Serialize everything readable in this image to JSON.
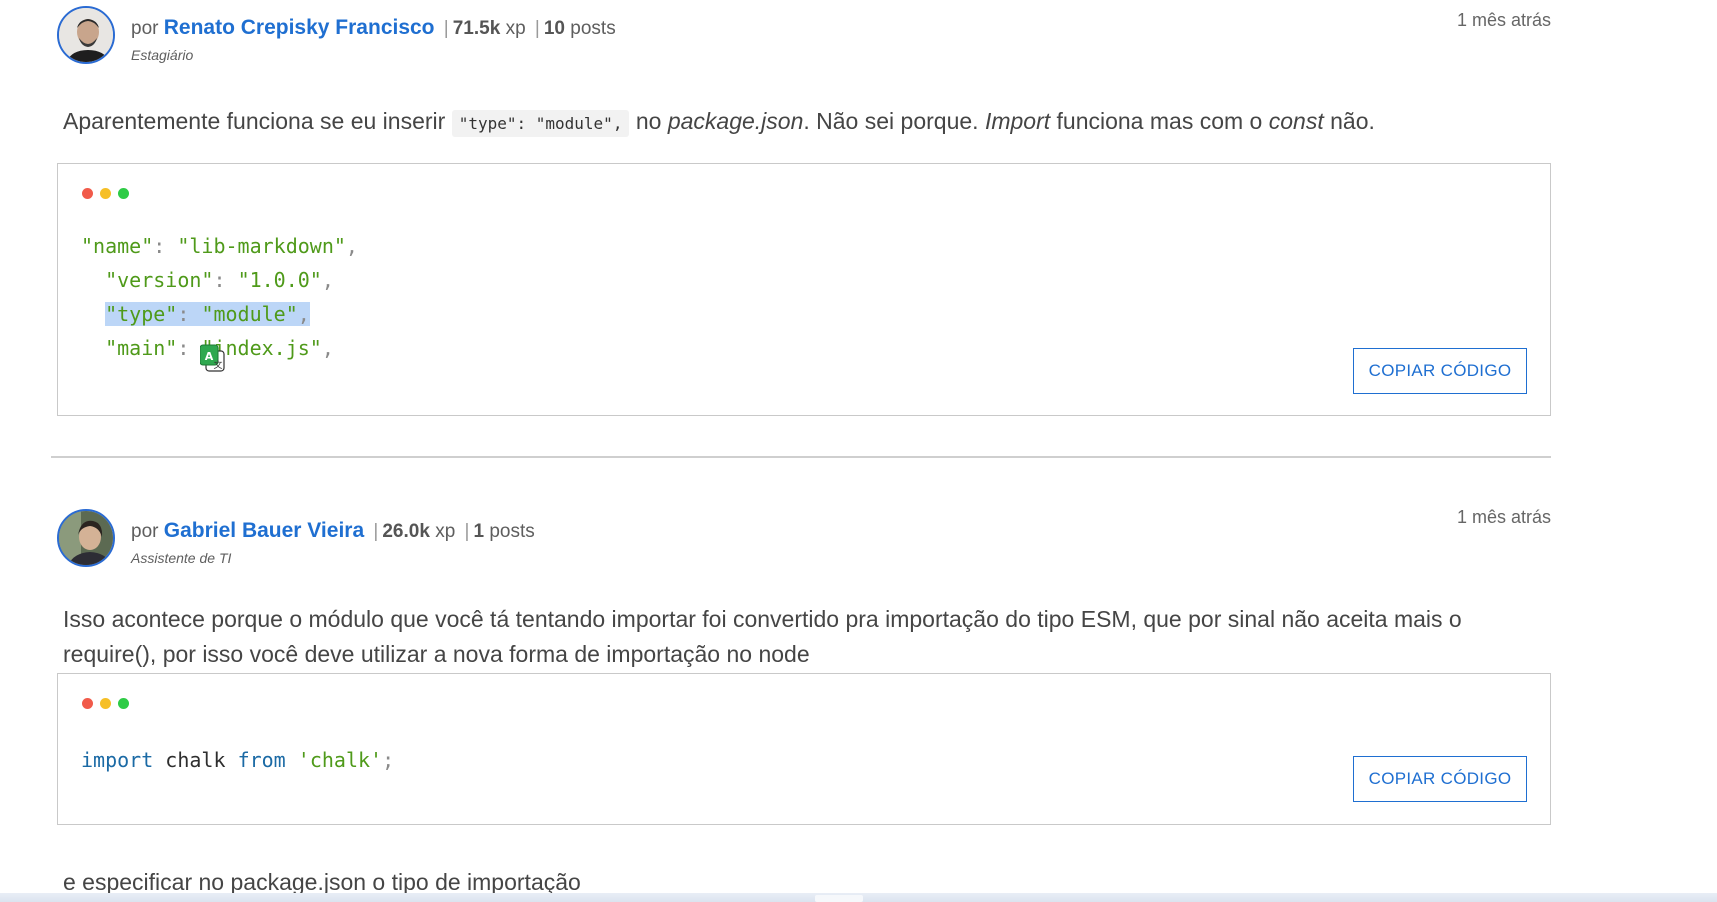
{
  "posts": [
    {
      "by": "por",
      "author": "Renato Crepisky Francisco",
      "xp_value": "71.5k",
      "xp_unit": "xp",
      "posts_count": "10",
      "posts_label": "posts",
      "role": "Estagiário",
      "time": "1 mês atrás",
      "text_parts": {
        "p1": "Aparentemente funciona se eu inserir ",
        "code": "\"type\": \"module\",",
        "p2": " no ",
        "em1": "package.json",
        "p3": ". Não sei porque. ",
        "em2": "Import",
        "p4": " funciona mas com o ",
        "em3": "const",
        "p5": " não."
      },
      "code_lines": [
        {
          "key": "\"name\"",
          "val": "\"lib-markdown\""
        },
        {
          "key": "\"version\"",
          "val": "\"1.0.0\""
        },
        {
          "key": "\"type\"",
          "val": "\"module\""
        },
        {
          "key": "\"main\"",
          "val": "\"index.js\""
        }
      ],
      "copy_label": "COPIAR CÓDIGO"
    },
    {
      "by": "por",
      "author": "Gabriel Bauer Vieira",
      "xp_value": "26.0k",
      "xp_unit": "xp",
      "posts_count": "1",
      "posts_label": "posts",
      "role": "Assistente de TI",
      "time": "1 mês atrás",
      "text": "Isso acontece porque o módulo que você tá tentando importar foi convertido pra importação do tipo ESM, que por sinal não aceita mais o require(), por isso você deve utilizar a nova forma de importação no node",
      "code": {
        "kw1": "import",
        "ident": "chalk",
        "kw2": "from",
        "str": "'chalk'",
        "end": ";"
      },
      "copy_label": "COPIAR CÓDIGO",
      "after_text": "e especificar no package.json o tipo de importação"
    }
  ],
  "colors": {
    "dot_red": "#f15a4a",
    "dot_yellow": "#f6bf26",
    "dot_green": "#2ecb46",
    "accent": "#1f6fd1"
  },
  "icons": {
    "translate": "translate-icon"
  }
}
